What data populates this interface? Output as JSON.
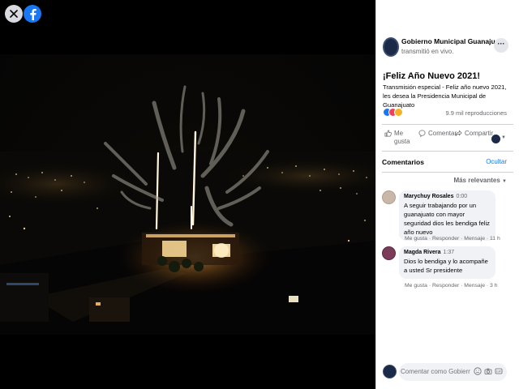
{
  "viewer": {
    "close_icon": "close-icon",
    "facebook_icon": "facebook-logo-icon"
  },
  "post": {
    "page_name": "Gobierno Municipal Guanajuato",
    "live_note": "transmitió en vivo.",
    "title": "¡Feliz Año Nuevo 2021!",
    "description": "Transmisión especial - Feliz año nuevo 2021, les desea la Presidencia Municipal de Guanajuato",
    "reactions": [
      "like",
      "love",
      "wow"
    ],
    "views": "9.9 mil reproducciones"
  },
  "actions": {
    "like_label": "Me gusta",
    "comment_label": "Comentar",
    "share_label": "Compartir"
  },
  "comments_section": {
    "header": "Comentarios",
    "hide_label": "Ocultar",
    "sort_label": "Más relevantes",
    "items": [
      {
        "author": "Marychuy Rosales",
        "time": "0:00",
        "text": "A seguir trabajando por un guanajuato con mayor seguridad dios les bendiga feliz año nuevo",
        "actions": "Me gusta · Responder · Mensaje · 11 h"
      },
      {
        "author": "Magda Rivera",
        "time": "1:37",
        "text": "Dios lo bendiga y lo acompañe a usted Sr presidente",
        "actions": "Me gusta · Responder · Mensaje · 3 h"
      }
    ]
  },
  "composer": {
    "placeholder": "Comentar como Gobierno..."
  },
  "colors": {
    "brand": "#1877f2",
    "bubble": "#f0f2f5",
    "secondary_text": "#65676b"
  }
}
